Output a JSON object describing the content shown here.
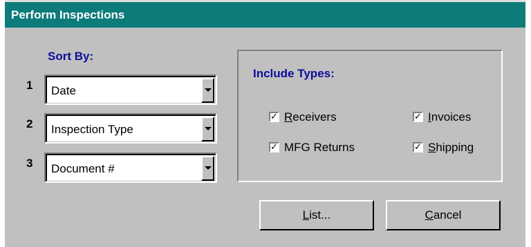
{
  "window": {
    "title": "Perform Inspections"
  },
  "sort": {
    "heading": "Sort By:",
    "rows": [
      {
        "number": "1",
        "value": "Date"
      },
      {
        "number": "2",
        "value": "Inspection Type"
      },
      {
        "number": "3",
        "value": "Document #"
      }
    ]
  },
  "include": {
    "heading": "Include Types:",
    "options": [
      {
        "mnemonic": "R",
        "rest": "eceivers",
        "checked": true
      },
      {
        "mnemonic": "I",
        "rest": "nvoices",
        "checked": true
      },
      {
        "mnemonic": "",
        "rest": "MFG Returns",
        "checked": true
      },
      {
        "mnemonic": "S",
        "rest": "hipping",
        "checked": true
      }
    ]
  },
  "buttons": {
    "list": {
      "mnemonic": "L",
      "rest": "ist..."
    },
    "cancel": {
      "mnemonic": "C",
      "rest": "ancel"
    }
  },
  "colors": {
    "titlebar": "#0e7b7b",
    "heading": "#0d0d9b",
    "face": "#c0c0c0"
  }
}
